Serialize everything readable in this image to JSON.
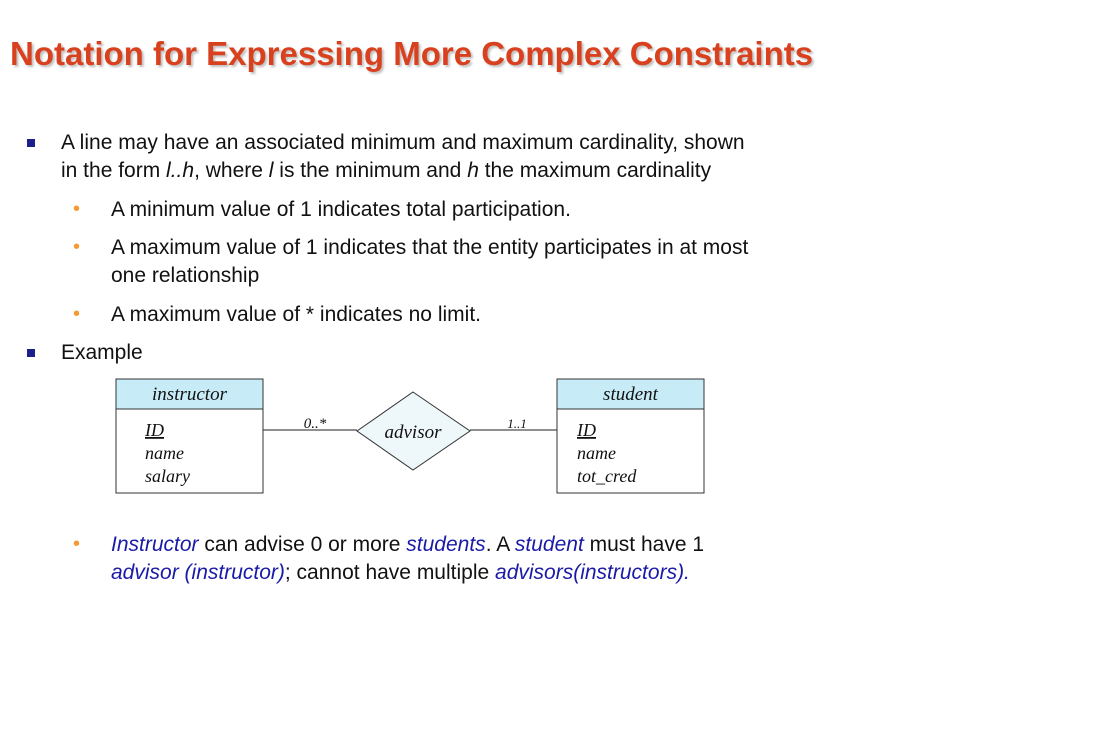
{
  "title": "Notation for Expressing More Complex Constraints",
  "bullet1": {
    "line1": "A line may have an associated minimum and maximum cardinality, shown",
    "line2_prefix": "in the form ",
    "line2_lh": "l..h",
    "line2_mid1": ", where ",
    "line2_l": "l",
    "line2_mid2": " is the minimum and ",
    "line2_h": "h",
    "line2_suffix": " the maximum cardinality"
  },
  "sub1": "A minimum value of 1 indicates total participation.",
  "sub2": {
    "line1": "A maximum value of 1 indicates that the entity participates  in at most",
    "line2": "one relationship"
  },
  "sub3": "A maximum value of * indicates no limit.",
  "example_label": "Example",
  "diagram": {
    "left_entity": {
      "name": "instructor",
      "attrs": [
        "ID",
        "name",
        "salary"
      ]
    },
    "right_entity": {
      "name": "student",
      "attrs": [
        "ID",
        "name",
        "tot_cred"
      ]
    },
    "relationship": "advisor",
    "left_cardinality": "0..*",
    "right_cardinality": "1..1",
    "header_fill": "#c7ecf8",
    "diamond_fill": "#eef8fb"
  },
  "note": {
    "p1_blue": "Instructor",
    "p2": " can advise 0 or more ",
    "p3_blue": "students",
    "p4": ".  A ",
    "p5_blue": "student",
    "p6": " must have 1",
    "l2_blue1": "advisor (instructor)",
    "l2_mid": "; cannot have multiple ",
    "l2_blue2": "advisors(instructors)."
  },
  "colors": {
    "title": "#d9411e",
    "bullet_square": "#1a1f8c",
    "bullet_dot": "#f39a35",
    "emphasis": "#1a1aa8"
  }
}
